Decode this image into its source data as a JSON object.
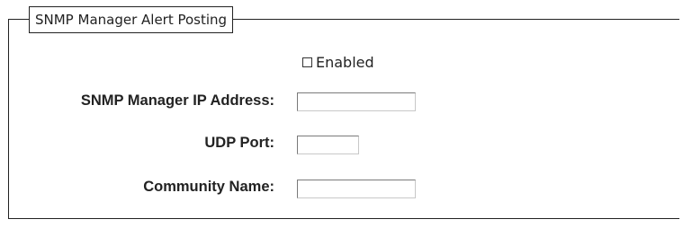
{
  "section": {
    "legend": "SNMP Manager Alert Posting"
  },
  "enabled": {
    "label": "Enabled",
    "checked": false
  },
  "fields": {
    "ip_address": {
      "label": "SNMP Manager IP Address:",
      "value": ""
    },
    "udp_port": {
      "label": "UDP Port:",
      "value": ""
    },
    "community_name": {
      "label": "Community Name:",
      "value": ""
    }
  }
}
